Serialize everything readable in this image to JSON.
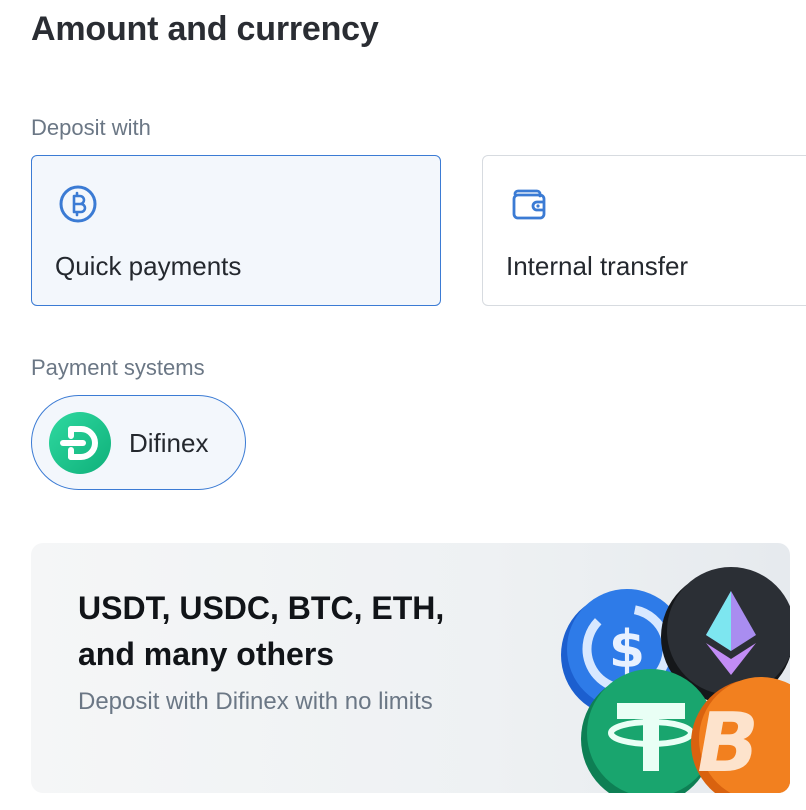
{
  "header": {
    "title": "Amount and currency"
  },
  "deposit": {
    "label": "Deposit with",
    "methods": [
      {
        "label": "Quick payments",
        "icon": "bitcoin-circle-icon",
        "selected": true
      },
      {
        "label": "Internal transfer",
        "icon": "wallet-icon",
        "selected": false
      }
    ]
  },
  "payment_systems": {
    "label": "Payment systems",
    "items": [
      {
        "label": "Difinex",
        "icon": "difinex-logo",
        "selected": true
      }
    ]
  },
  "promo": {
    "headline_line1": "USDT, USDC, BTC, ETH,",
    "headline_line2": "and many others",
    "subtext": "Deposit with Difinex with no limits",
    "icons": [
      "usdc-coin-icon",
      "eth-coin-icon",
      "tether-coin-icon",
      "bitcoin-coin-icon"
    ]
  },
  "colors": {
    "accent": "#3b7bd4",
    "selected_bg": "#f3f7fc",
    "muted_text": "#6b7785"
  }
}
